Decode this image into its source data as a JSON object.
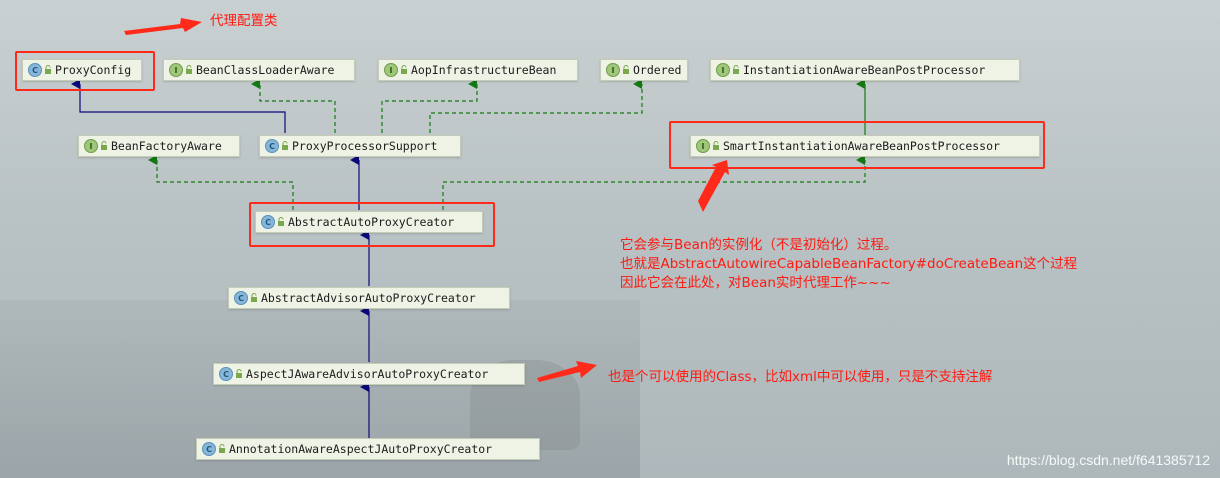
{
  "nodes": {
    "proxy_config": {
      "kind": "C",
      "label": "ProxyConfig"
    },
    "bean_class_loader_aware": {
      "kind": "I",
      "label": "BeanClassLoaderAware"
    },
    "aop_infrastructure_bean": {
      "kind": "I",
      "label": "AopInfrastructureBean"
    },
    "ordered": {
      "kind": "I",
      "label": "Ordered"
    },
    "instantiation_aware_bpp": {
      "kind": "I",
      "label": "InstantiationAwareBeanPostProcessor"
    },
    "bean_factory_aware": {
      "kind": "I",
      "label": "BeanFactoryAware"
    },
    "proxy_processor_support": {
      "kind": "C",
      "label": "ProxyProcessorSupport"
    },
    "smart_instantiation_aware_bpp": {
      "kind": "I",
      "label": "SmartInstantiationAwareBeanPostProcessor"
    },
    "abstract_auto_proxy_creator": {
      "kind": "C",
      "label": "AbstractAutoProxyCreator"
    },
    "abstract_advisor_auto_proxy_creator": {
      "kind": "C",
      "label": "AbstractAdvisorAutoProxyCreator"
    },
    "aspectj_aware_advisor_auto_proxy_creator": {
      "kind": "C",
      "label": "AspectJAwareAdvisorAutoProxyCreator"
    },
    "annotation_aware_aspectj_auto_proxy_creator": {
      "kind": "C",
      "label": "AnnotationAwareAspectJAutoProxyCreator"
    }
  },
  "annotations": {
    "proxy_config_note": "代理配置类",
    "smart_note": [
      "它会参与Bean的实例化（不是初始化）过程。",
      "也就是AbstractAutowireCapableBeanFactory#doCreateBean这个过程",
      "因此它会在此处，对Bean实时代理工作~~~"
    ],
    "aspectj_note": "也是个可以使用的Class，比如xml中可以使用，只是不支持注解"
  },
  "watermark": "https://blog.csdn.net/f641385712",
  "colors": {
    "extends_edge": "#0a0a7a",
    "implements_edge": "#137a13",
    "highlight": "#ff2a1a",
    "note_text": "#ff1a10"
  }
}
